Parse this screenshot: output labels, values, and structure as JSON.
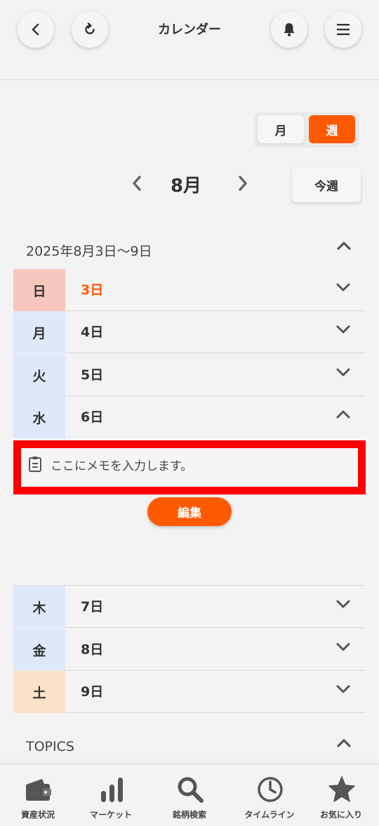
{
  "header": {
    "title": "カレンダー",
    "back_icon": "chevron-left-icon",
    "refresh_icon": "refresh-icon",
    "bell_icon": "bell-icon",
    "menu_icon": "hamburger-menu-icon"
  },
  "view_toggle": {
    "month_label": "月",
    "week_label": "週",
    "selected": "週"
  },
  "month_nav": {
    "month_label": "8月",
    "this_week_label": "今週"
  },
  "week": {
    "range_label": "2025年8月3日〜9日",
    "days": [
      {
        "weekday": "日",
        "date": "3日",
        "expanded": false
      },
      {
        "weekday": "月",
        "date": "4日",
        "expanded": false
      },
      {
        "weekday": "火",
        "date": "5日",
        "expanded": false
      },
      {
        "weekday": "水",
        "date": "6日",
        "expanded": true
      },
      {
        "weekday": "木",
        "date": "7日",
        "expanded": false
      },
      {
        "weekday": "金",
        "date": "8日",
        "expanded": false
      },
      {
        "weekday": "土",
        "date": "9日",
        "expanded": false
      }
    ],
    "memo_text": "ここにメモを入力します。",
    "edit_label": "編集"
  },
  "topics": {
    "label": "TOPICS"
  },
  "bottom_nav": {
    "items": [
      {
        "label": "資産状況",
        "icon": "wallet-icon"
      },
      {
        "label": "マーケット",
        "icon": "bar-chart-icon"
      },
      {
        "label": "銘柄検索",
        "icon": "search-icon"
      },
      {
        "label": "タイムライン",
        "icon": "clock-icon"
      },
      {
        "label": "お気に入り",
        "icon": "star-icon"
      }
    ]
  },
  "colors": {
    "accent": "#ff5a00",
    "sunday": "#f8c6bd",
    "weekday": "#dde9fb",
    "saturday": "#fbe3c8",
    "highlight_border": "#ff0000"
  }
}
